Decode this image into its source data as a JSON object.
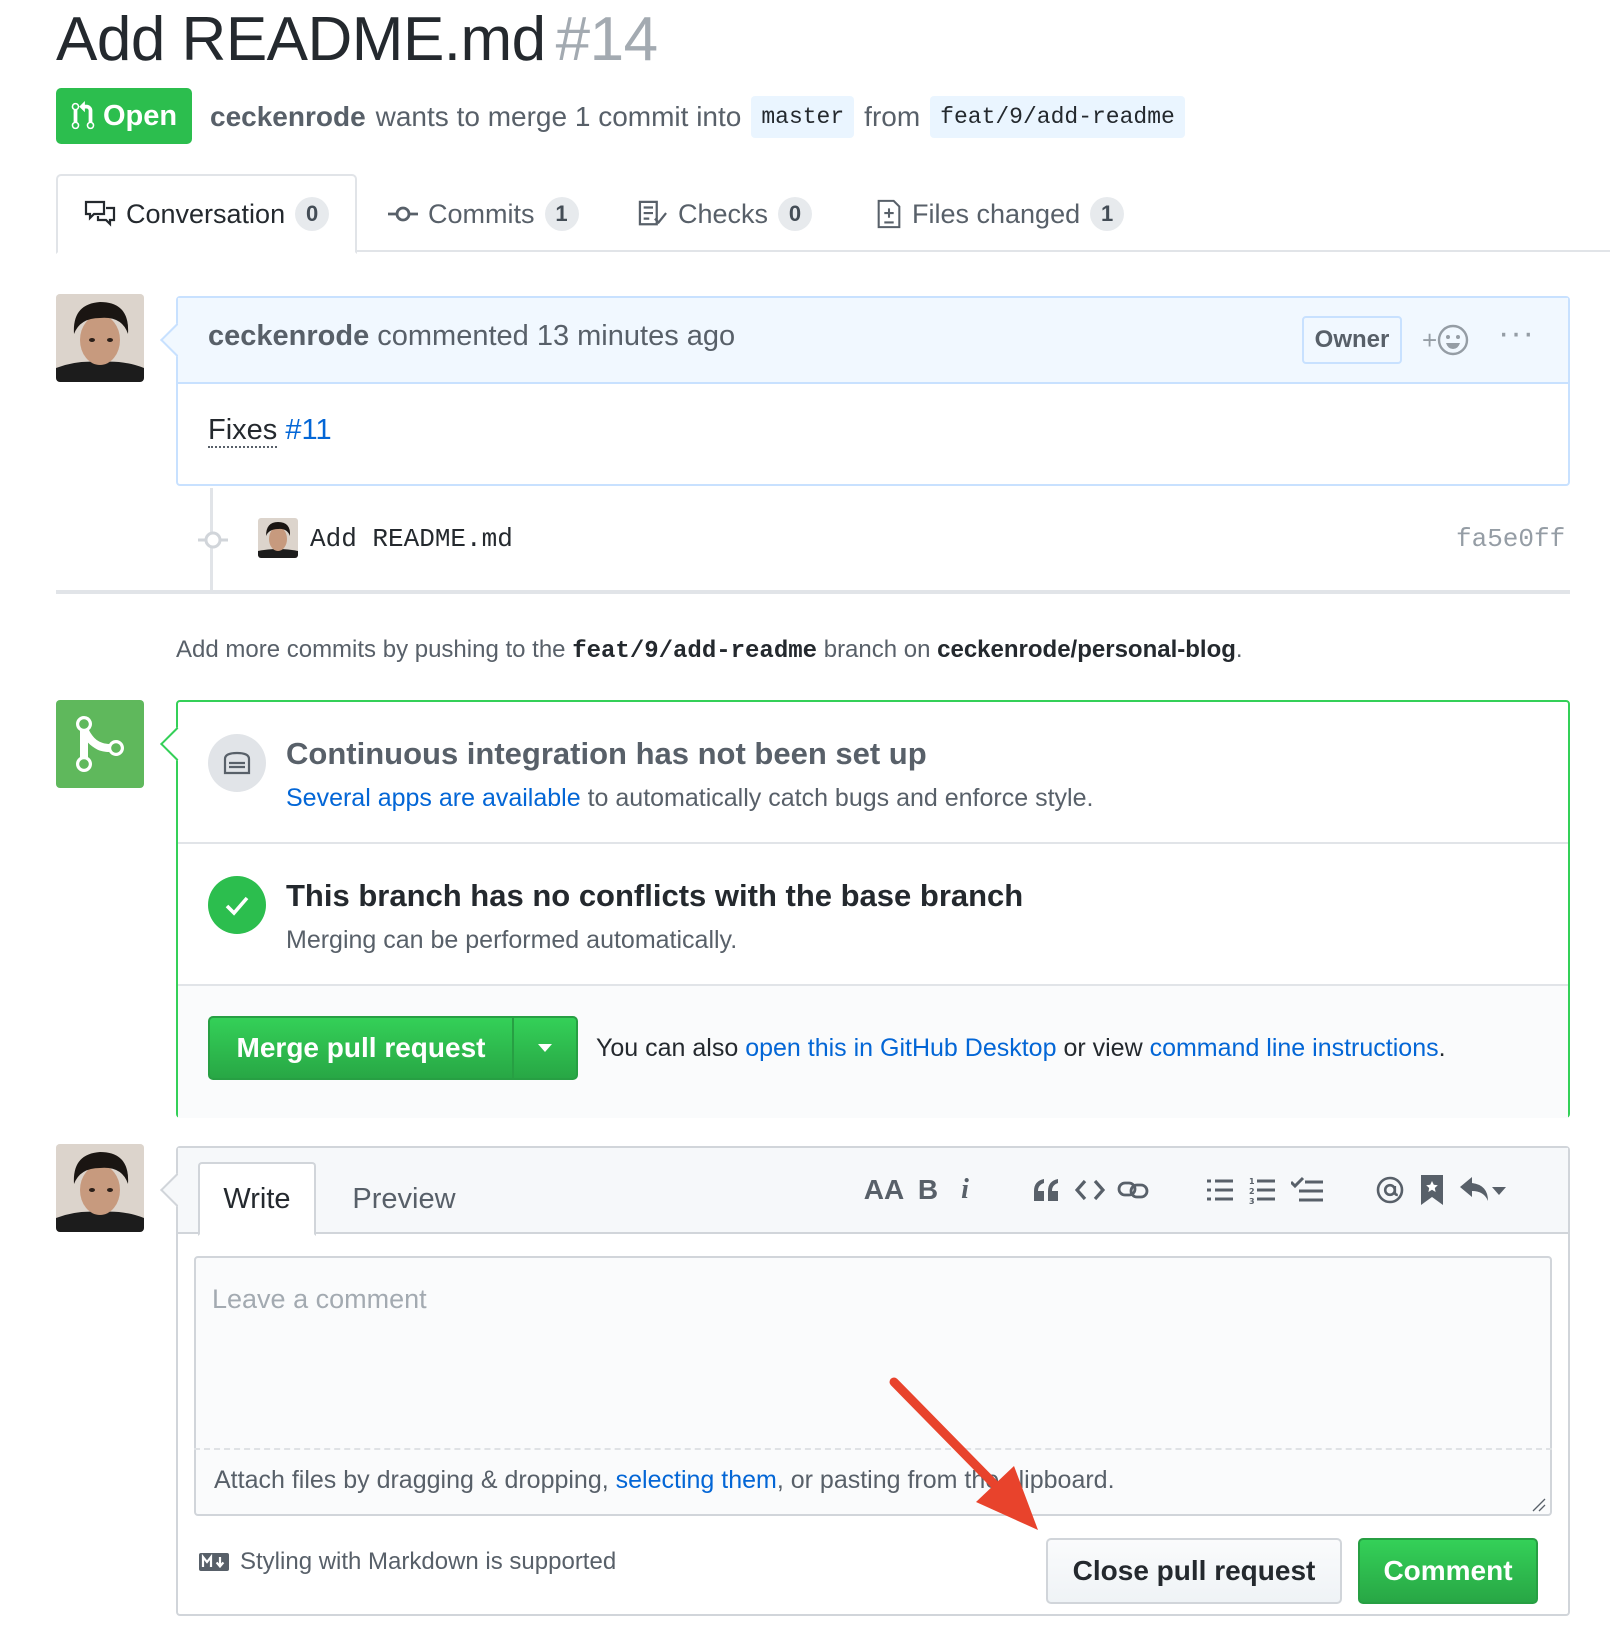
{
  "pr": {
    "title": "Add README.md",
    "number": "#14",
    "state": "Open",
    "author": "ceckenrode",
    "merge_text": "wants to merge 1 commit into",
    "base_branch": "master",
    "from_text": "from",
    "head_branch": "feat/9/add-readme"
  },
  "tabs": [
    {
      "label": "Conversation",
      "count": "0",
      "icon": "comment-discussion-icon"
    },
    {
      "label": "Commits",
      "count": "1",
      "icon": "git-commit-icon"
    },
    {
      "label": "Checks",
      "count": "0",
      "icon": "checklist-icon"
    },
    {
      "label": "Files changed",
      "count": "1",
      "icon": "diff-icon"
    }
  ],
  "comment": {
    "author": "ceckenrode",
    "action": "commented 13 minutes ago",
    "badge": "Owner",
    "reaction_plus": "+",
    "more": "···",
    "body_text": "Fixes",
    "body_link": "#11"
  },
  "commit": {
    "message": "Add README.md",
    "sha": "fa5e0ff"
  },
  "hint": {
    "prefix": "Add more commits by pushing to the",
    "branch": "feat/9/add-readme",
    "middle": "branch on",
    "repo": "ceckenrode/personal-blog",
    "suffix": "."
  },
  "merge": {
    "ci_title": "Continuous integration has not been set up",
    "ci_link": "Several apps are available",
    "ci_rest": "to automatically catch bugs and enforce style.",
    "conflict_title": "This branch has no conflicts with the base branch",
    "conflict_sub": "Merging can be performed automatically.",
    "merge_button": "Merge pull request",
    "also_prefix": "You can also",
    "also_link1": "open this in GitHub Desktop",
    "also_middle": "or view",
    "also_link2": "command line instructions",
    "also_suffix": "."
  },
  "new_comment": {
    "tab_write": "Write",
    "tab_preview": "Preview",
    "toolbar": {
      "heading": "AA",
      "bold": "B",
      "italic": "i"
    },
    "placeholder": "Leave a comment",
    "attach_prefix": "Attach files by dragging & dropping,",
    "attach_link": "selecting them",
    "attach_suffix": ", or pasting from the clipboard.",
    "markdown_note": "Styling with Markdown is supported",
    "close_button": "Close pull request",
    "comment_button": "Comment"
  },
  "colors": {
    "green": "#2cbe4e",
    "blue_link": "#0366d6",
    "annotation_arrow": "#e8432c"
  }
}
